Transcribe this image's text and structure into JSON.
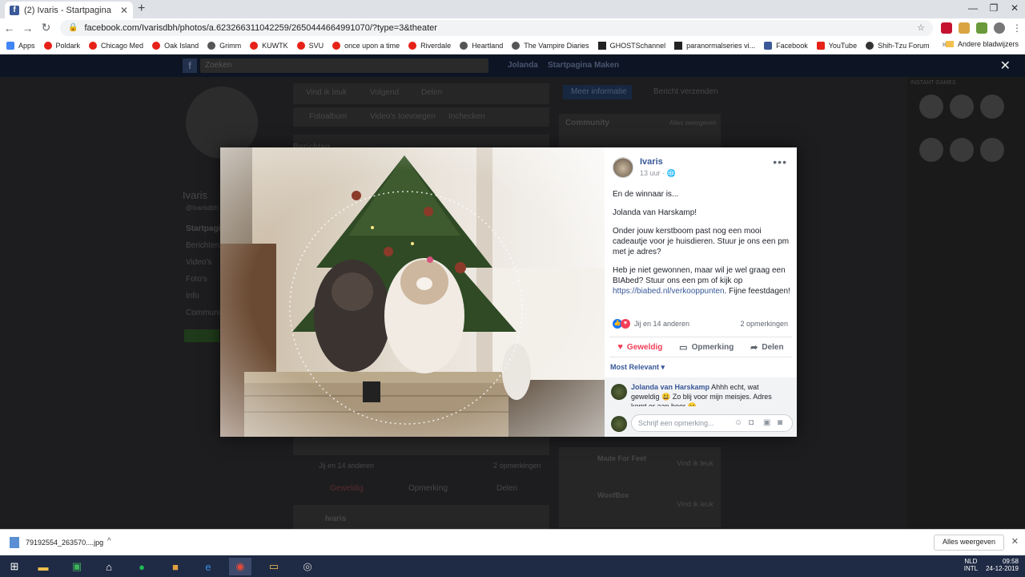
{
  "browser": {
    "tab_title": "(2) Ivaris - Startpagina",
    "url": "facebook.com/Ivarisdbh/photos/a.623266311042259/2650444664991070/?type=3&theater",
    "bookmarks": [
      {
        "label": "Apps",
        "color": "#4285f4"
      },
      {
        "label": "Poldark",
        "color": "#e62117"
      },
      {
        "label": "Chicago Med",
        "color": "#e62117"
      },
      {
        "label": "Oak Island",
        "color": "#e62117"
      },
      {
        "label": "Grimm",
        "color": "#555555"
      },
      {
        "label": "KUWTK",
        "color": "#e62117"
      },
      {
        "label": "SVU",
        "color": "#e62117"
      },
      {
        "label": "once upon a time",
        "color": "#e62117"
      },
      {
        "label": "Riverdale",
        "color": "#e62117"
      },
      {
        "label": "Heartland",
        "color": "#555555"
      },
      {
        "label": "The Vampire Diaries",
        "color": "#555555"
      },
      {
        "label": "GHOSTSchannel",
        "color": "#222222"
      },
      {
        "label": "paranormalseries vi...",
        "color": "#222222"
      },
      {
        "label": "Facebook",
        "color": "#3b5998"
      },
      {
        "label": "YouTube",
        "color": "#e62117"
      },
      {
        "label": "Shih-Tzu Forum",
        "color": "#333333"
      }
    ],
    "other_bookmarks": "Andere bladwijzers"
  },
  "fb_background": {
    "search_placeholder": "Zoeken",
    "nav_name": "Jolanda",
    "nav_home": "Startpagina",
    "nav_create": "Maken",
    "page_name": "Ivaris",
    "page_handle": "@Ivarisdbh",
    "menu": [
      "Startpagina",
      "Berichten",
      "Video's",
      "Foto's",
      "Info",
      "Community"
    ],
    "like_page": "Vind ik leuk",
    "follow": "Volgend",
    "share": "Delen",
    "more_info": "Meer informatie",
    "send_message": "Bericht verzenden",
    "photos": "Fotoalbum",
    "videos": "Video's toevoegen",
    "checkin": "Inchecken",
    "community": "Community",
    "see_all": "Alles weergeven",
    "section_posts": "Berichten",
    "liked_count": "Jij en 14 anderen",
    "comments": "2 opmerkingen",
    "like_action": "Geweldig",
    "comment_action": "Opmerking",
    "share_action": "Delen",
    "post_author": "Ivaris",
    "contacts_title": "INSTANT GAMES",
    "suggestion1": "Made For Feet",
    "suggestion2": "WoofBox",
    "like_button": "Vind ik leuk"
  },
  "post": {
    "author": "Ivaris",
    "time": "13 uur",
    "more": "•••",
    "paragraphs": [
      "En de winnaar is...",
      "Jolanda van Harskamp!",
      "Onder jouw kerstboom past nog een mooi cadeautje voor je huisdieren. Stuur je ons een pm met je adres?"
    ],
    "last_paragraph": "Heb je niet gewonnen, maar wil je wel graag een BIAbed? Stuur ons een pm of kijk op",
    "link": "https://biabed.nl/verkooppunten",
    "last_paragraph_end": ". Fijne feestdagen!",
    "reactions_text": "Jij en 14 anderen",
    "comments_count": "2 opmerkingen",
    "like_label": "Geweldig",
    "comment_label": "Opmerking",
    "share_label": "Delen",
    "sort_label": "Most Relevant ▾",
    "comment": {
      "author": "Jolanda van Harskamp",
      "text": "Ahhh echt, wat geweldig 😃 Zo blij voor mijn meisjes. Adres komt er aan hoor 😊"
    },
    "comment_placeholder": "Schrijf een opmerking..."
  },
  "downloads": {
    "file": "79192554_263570....jpg",
    "show_all": "Alles weergeven"
  },
  "taskbar": {
    "lang1": "NLD",
    "lang2": "INTL",
    "time": "09:58",
    "date": "24-12-2019"
  }
}
